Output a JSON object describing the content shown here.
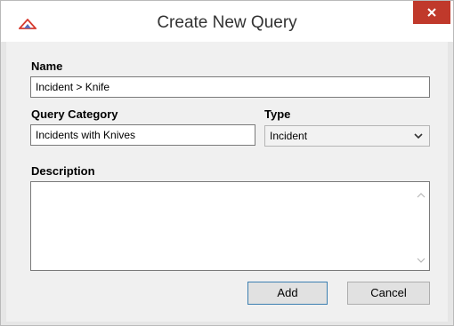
{
  "window": {
    "title": "Create New Query"
  },
  "form": {
    "name_label": "Name",
    "name_value": "Incident > Knife",
    "category_label": "Query Category",
    "category_value": "Incidents with Knives",
    "type_label": "Type",
    "type_selected": "Incident",
    "description_label": "Description",
    "description_value": ""
  },
  "buttons": {
    "add": "Add",
    "cancel": "Cancel"
  },
  "colors": {
    "close_button": "#c0392b",
    "app_icon_accent": "#d63a2f"
  },
  "icons": {
    "app": "triangle-logo-icon",
    "close": "close-icon",
    "dropdown": "chevron-down-icon"
  }
}
